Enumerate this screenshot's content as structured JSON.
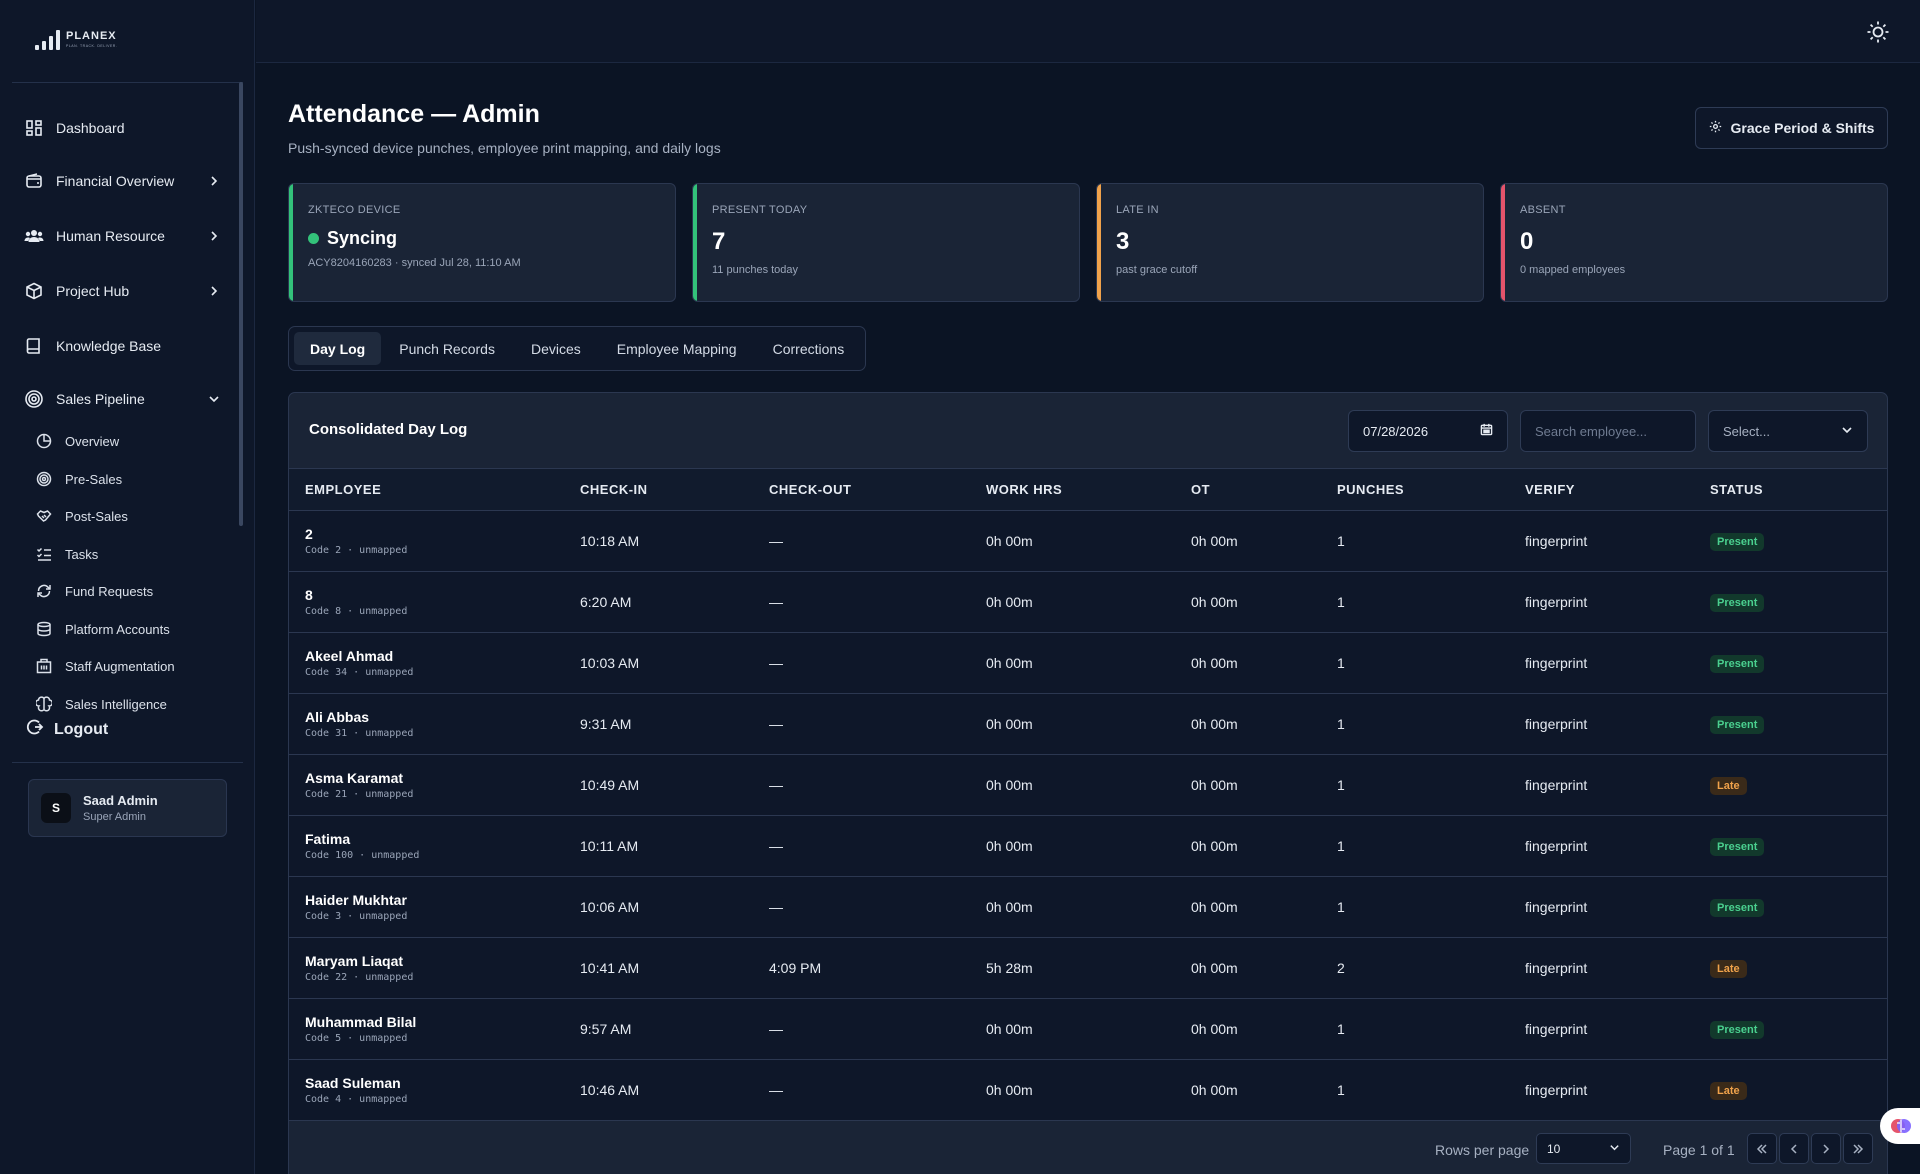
{
  "app": {
    "logo_name": "PLANEX",
    "logo_tagline": "PLAN. TRACK. DELIVER."
  },
  "sidebar": {
    "items": [
      {
        "label": "Dashboard",
        "icon": "grid-icon"
      },
      {
        "label": "Financial Overview",
        "icon": "wallet-icon"
      },
      {
        "label": "Human Resource",
        "icon": "users-icon"
      },
      {
        "label": "Project Hub",
        "icon": "box-icon"
      },
      {
        "label": "Knowledge Base",
        "icon": "book-icon"
      },
      {
        "label": "Sales Pipeline",
        "icon": "target-icon"
      }
    ],
    "sub_items": [
      {
        "label": "Overview",
        "icon": "pie-chart-icon"
      },
      {
        "label": "Pre-Sales",
        "icon": "target-icon"
      },
      {
        "label": "Post-Sales",
        "icon": "handshake-icon"
      },
      {
        "label": "Tasks",
        "icon": "checklist-icon"
      },
      {
        "label": "Fund Requests",
        "icon": "refresh-icon"
      },
      {
        "label": "Platform Accounts",
        "icon": "database-icon"
      },
      {
        "label": "Staff Augmentation",
        "icon": "building-icon"
      },
      {
        "label": "Sales Intelligence",
        "icon": "brain-icon"
      }
    ],
    "logout_label": "Logout",
    "user": {
      "initial": "S",
      "name": "Saad Admin",
      "role": "Super Admin"
    }
  },
  "page": {
    "title": "Attendance — Admin",
    "subtitle": "Push-synced device punches, employee print mapping, and daily logs",
    "grace_button": "Grace Period & Shifts"
  },
  "stats": {
    "device": {
      "label": "ZKTECO DEVICE",
      "status": "Syncing",
      "foot": "ACY8204160283 · synced Jul 28, 11:10 AM",
      "accent": "#33c27a"
    },
    "present": {
      "label": "PRESENT TODAY",
      "value": "7",
      "foot": "11 punches today",
      "accent": "#33c27a"
    },
    "late": {
      "label": "LATE IN",
      "value": "3",
      "foot": "past grace cutoff",
      "accent": "#f0a24b"
    },
    "absent": {
      "label": "ABSENT",
      "value": "0",
      "foot": "0 mapped employees",
      "accent": "#e5546b"
    }
  },
  "tabs": [
    "Day Log",
    "Punch Records",
    "Devices",
    "Employee Mapping",
    "Corrections"
  ],
  "panel": {
    "title": "Consolidated Day Log",
    "date_value": "07/28/2026",
    "search_placeholder": "Search employee...",
    "select_value": "Select..."
  },
  "table": {
    "headers": [
      "EMPLOYEE",
      "CHECK-IN",
      "CHECK-OUT",
      "WORK HRS",
      "OT",
      "PUNCHES",
      "VERIFY",
      "STATUS"
    ],
    "rows": [
      {
        "name": "2",
        "meta": "Code 2 · unmapped",
        "check_in": "10:18 AM",
        "check_out": "—",
        "work": "0h 00m",
        "ot": "0h 00m",
        "punches": "1",
        "verify": "fingerprint",
        "status": "Present"
      },
      {
        "name": "8",
        "meta": "Code 8 · unmapped",
        "check_in": "6:20 AM",
        "check_out": "—",
        "work": "0h 00m",
        "ot": "0h 00m",
        "punches": "1",
        "verify": "fingerprint",
        "status": "Present"
      },
      {
        "name": "Akeel Ahmad",
        "meta": "Code 34 · unmapped",
        "check_in": "10:03 AM",
        "check_out": "—",
        "work": "0h 00m",
        "ot": "0h 00m",
        "punches": "1",
        "verify": "fingerprint",
        "status": "Present"
      },
      {
        "name": "Ali Abbas",
        "meta": "Code 31 · unmapped",
        "check_in": "9:31 AM",
        "check_out": "—",
        "work": "0h 00m",
        "ot": "0h 00m",
        "punches": "1",
        "verify": "fingerprint",
        "status": "Present"
      },
      {
        "name": "Asma Karamat",
        "meta": "Code 21 · unmapped",
        "check_in": "10:49 AM",
        "check_out": "—",
        "work": "0h 00m",
        "ot": "0h 00m",
        "punches": "1",
        "verify": "fingerprint",
        "status": "Late"
      },
      {
        "name": "Fatima",
        "meta": "Code 100 · unmapped",
        "check_in": "10:11 AM",
        "check_out": "—",
        "work": "0h 00m",
        "ot": "0h 00m",
        "punches": "1",
        "verify": "fingerprint",
        "status": "Present"
      },
      {
        "name": "Haider Mukhtar",
        "meta": "Code 3 · unmapped",
        "check_in": "10:06 AM",
        "check_out": "—",
        "work": "0h 00m",
        "ot": "0h 00m",
        "punches": "1",
        "verify": "fingerprint",
        "status": "Present"
      },
      {
        "name": "Maryam Liaqat",
        "meta": "Code 22 · unmapped",
        "check_in": "10:41 AM",
        "check_out": "4:09 PM",
        "work": "5h 28m",
        "ot": "0h 00m",
        "punches": "2",
        "verify": "fingerprint",
        "status": "Late"
      },
      {
        "name": "Muhammad Bilal",
        "meta": "Code 5 · unmapped",
        "check_in": "9:57 AM",
        "check_out": "—",
        "work": "0h 00m",
        "ot": "0h 00m",
        "punches": "1",
        "verify": "fingerprint",
        "status": "Present"
      },
      {
        "name": "Saad Suleman",
        "meta": "Code 4 · unmapped",
        "check_in": "10:46 AM",
        "check_out": "—",
        "work": "0h 00m",
        "ot": "0h 00m",
        "punches": "1",
        "verify": "fingerprint",
        "status": "Late"
      }
    ]
  },
  "pagination": {
    "rows_per_page_label": "Rows per page",
    "rows_per_page_value": "10",
    "page_info": "Page 1 of 1"
  }
}
